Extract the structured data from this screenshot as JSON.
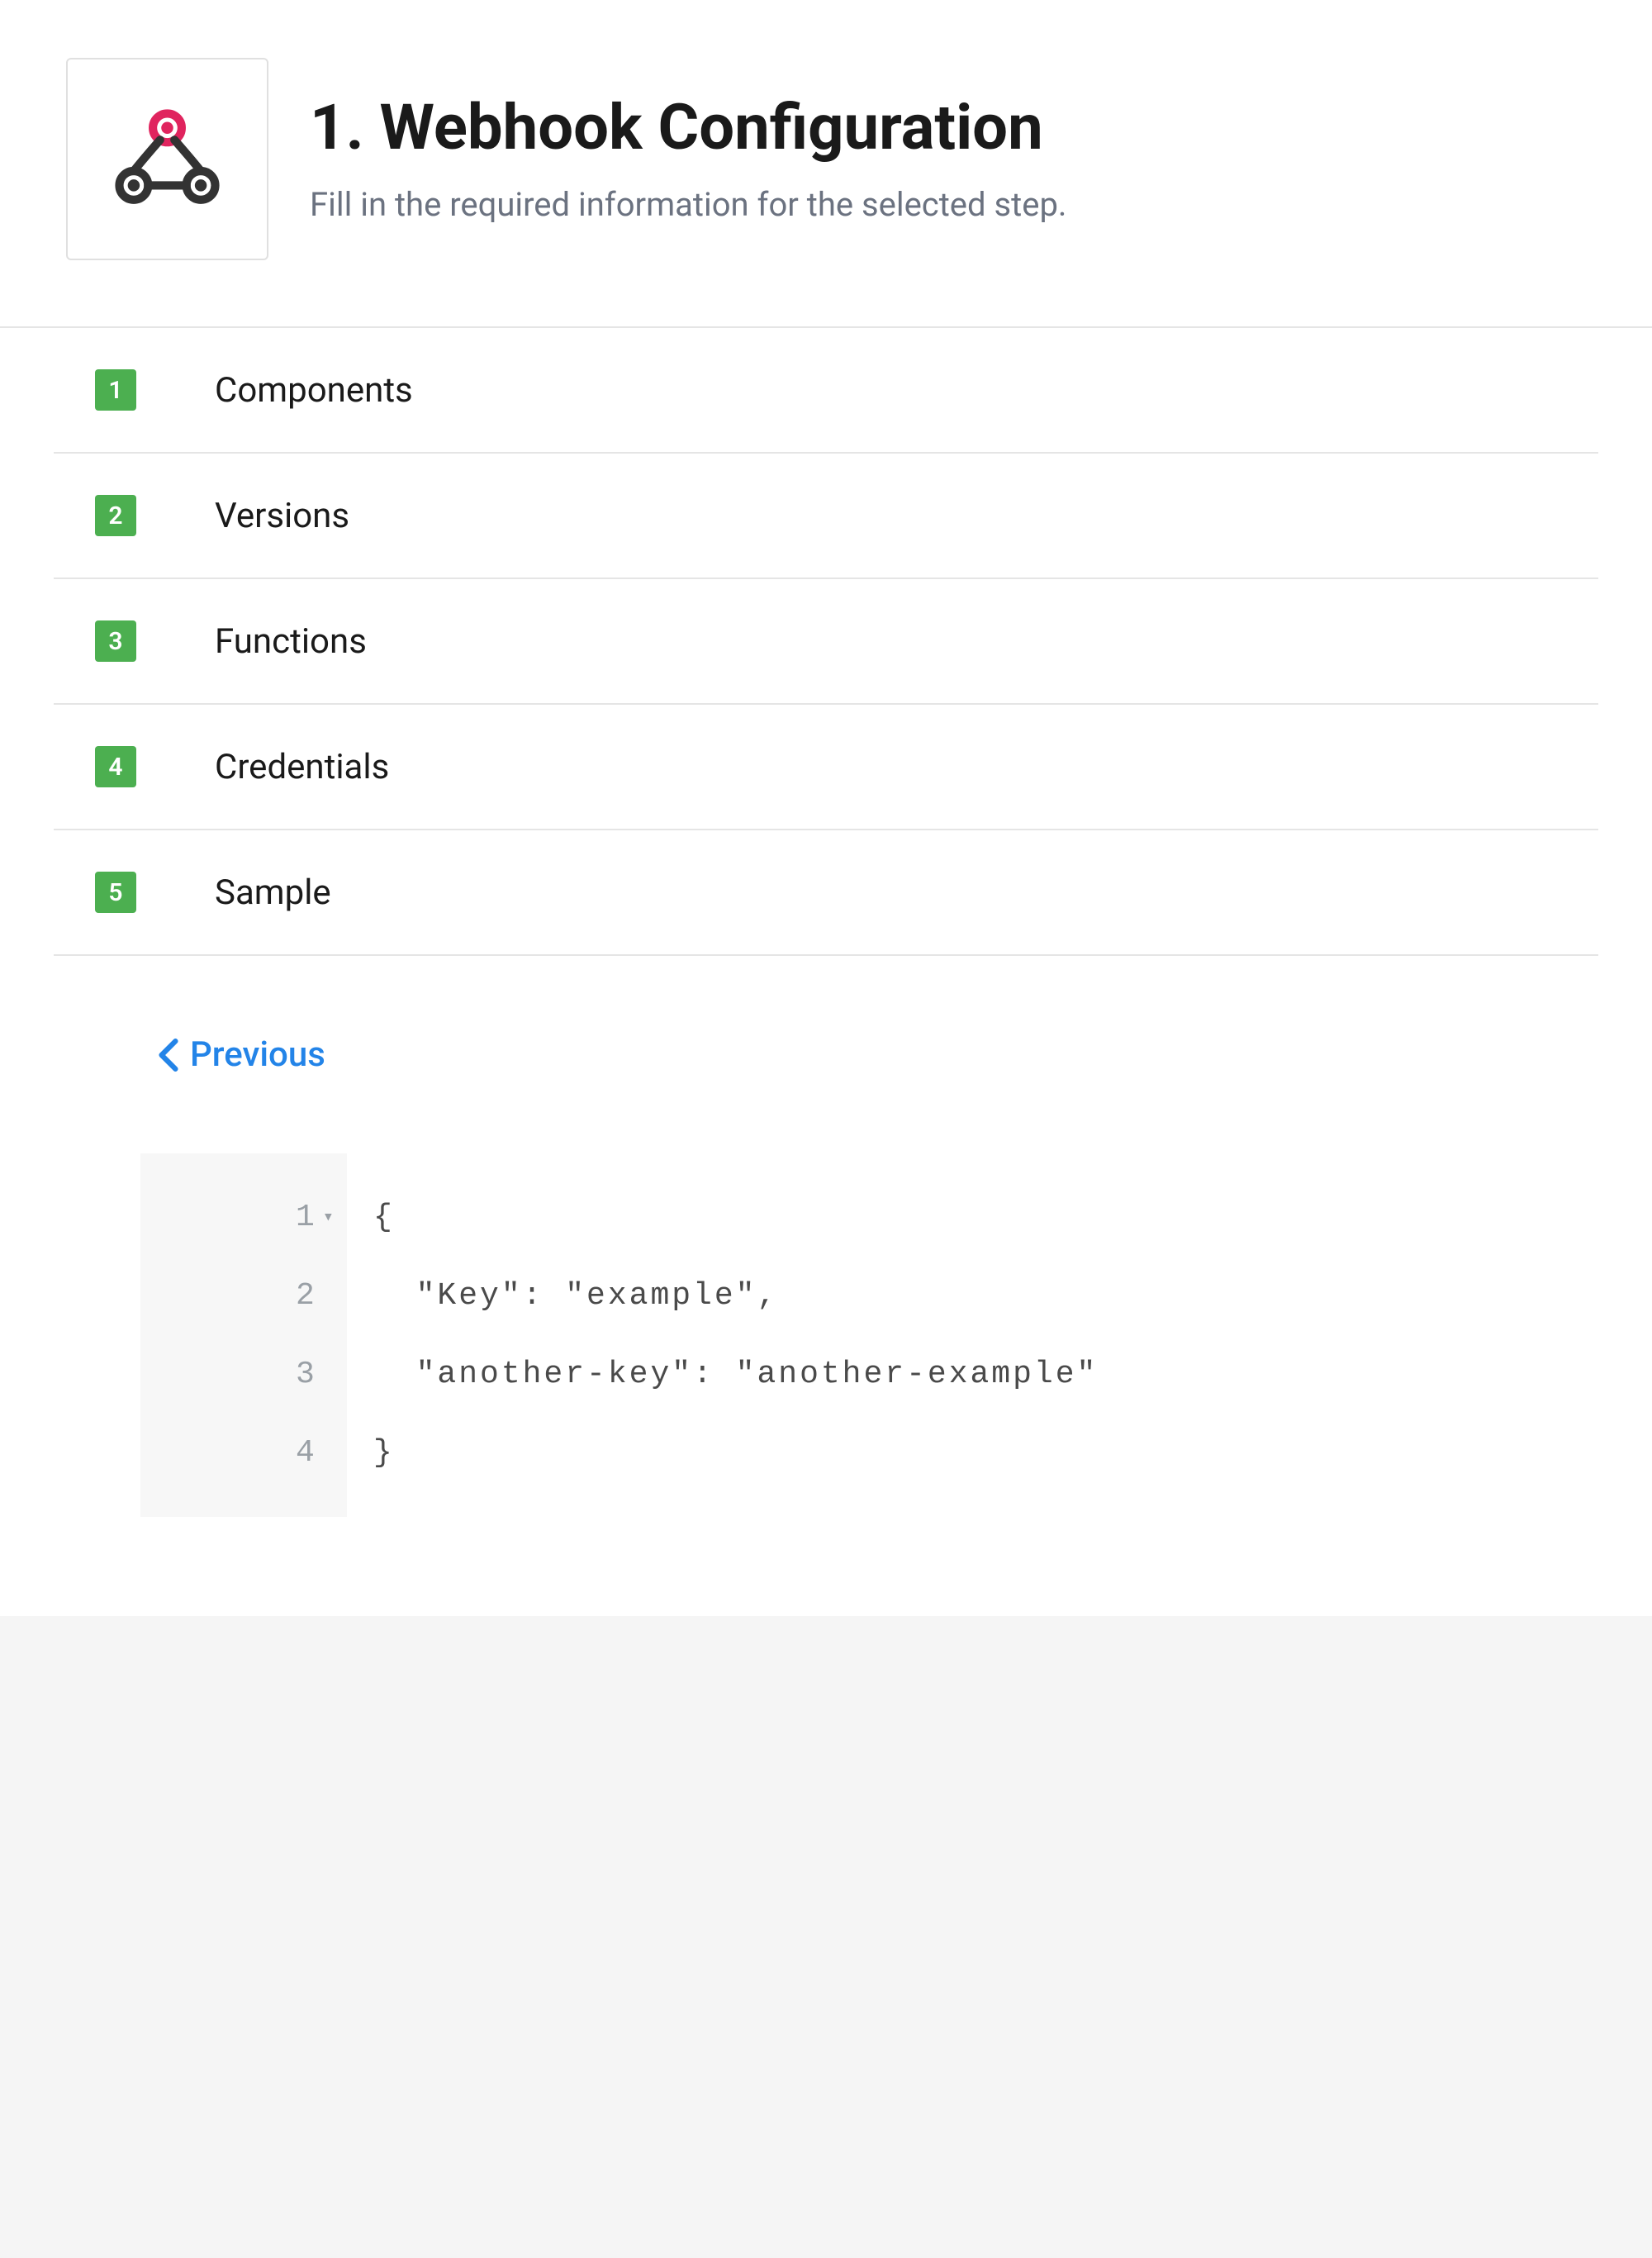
{
  "header": {
    "title": "1. Webhook Configuration",
    "subtitle": "Fill in the required information for the selected step."
  },
  "steps": [
    {
      "number": "1",
      "label": "Components"
    },
    {
      "number": "2",
      "label": "Versions"
    },
    {
      "number": "3",
      "label": "Functions"
    },
    {
      "number": "4",
      "label": "Credentials"
    },
    {
      "number": "5",
      "label": "Sample"
    }
  ],
  "nav": {
    "previous_label": "Previous"
  },
  "code": {
    "lines": [
      {
        "num": "1",
        "text": "{",
        "fold": true
      },
      {
        "num": "2",
        "text": "  \"Key\": \"example\","
      },
      {
        "num": "3",
        "text": "  \"another-key\": \"another-example\""
      },
      {
        "num": "4",
        "text": "}"
      }
    ]
  }
}
